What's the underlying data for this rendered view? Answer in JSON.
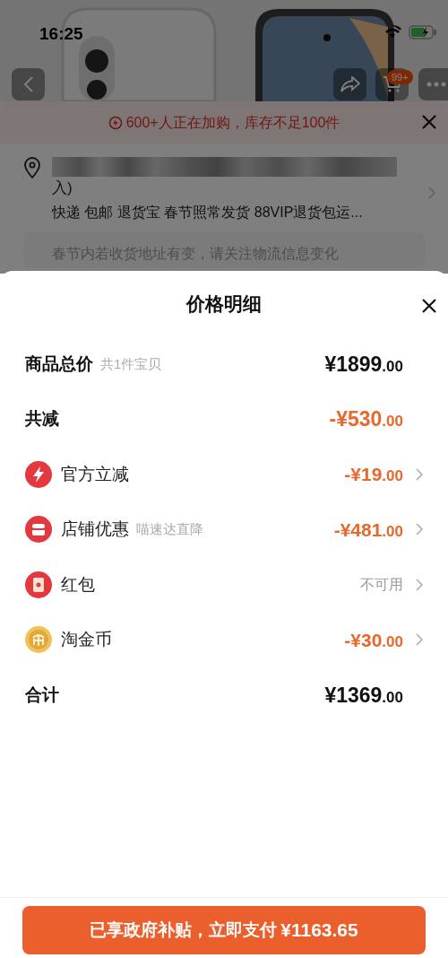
{
  "status_bar": {
    "time": "16:25"
  },
  "nav": {
    "cart_badge": "99+"
  },
  "stock_banner": {
    "text": "600+人正在加购，库存不足100件"
  },
  "address": {
    "line_end": "入)",
    "services": "快递 包邮 退货宝 春节照常发货 88VIP退货包运...",
    "notice": "春节内若收货地址有变，请关注物流信息变化"
  },
  "sheet": {
    "title": "价格明细",
    "rows": [
      {
        "kind": "total",
        "label": "商品总价",
        "note": "共1件宝贝",
        "main": "¥1899",
        "cents": ".00",
        "has_arrow": false
      },
      {
        "kind": "discount",
        "label": "共减",
        "main": "-¥530",
        "cents": ".00",
        "has_arrow": false
      },
      {
        "kind": "discount",
        "label": "官方立减",
        "main": "-¥19",
        "cents": ".00",
        "has_arrow": true
      },
      {
        "kind": "discount",
        "label": "店铺优惠",
        "note": "喵速达直降",
        "main": "-¥481",
        "cents": ".00",
        "has_arrow": true
      },
      {
        "kind": "unavailable",
        "label": "红包",
        "status": "不可用",
        "has_arrow": true
      },
      {
        "kind": "discount",
        "label": "淘金币",
        "main": "-¥30",
        "cents": ".00",
        "has_arrow": true
      },
      {
        "kind": "total",
        "label": "合计",
        "main": "¥1369",
        "cents": ".00",
        "has_arrow": false
      }
    ]
  },
  "pay_button": {
    "text": "已享政府补贴，立即支付",
    "amount": "¥1163.65"
  }
}
